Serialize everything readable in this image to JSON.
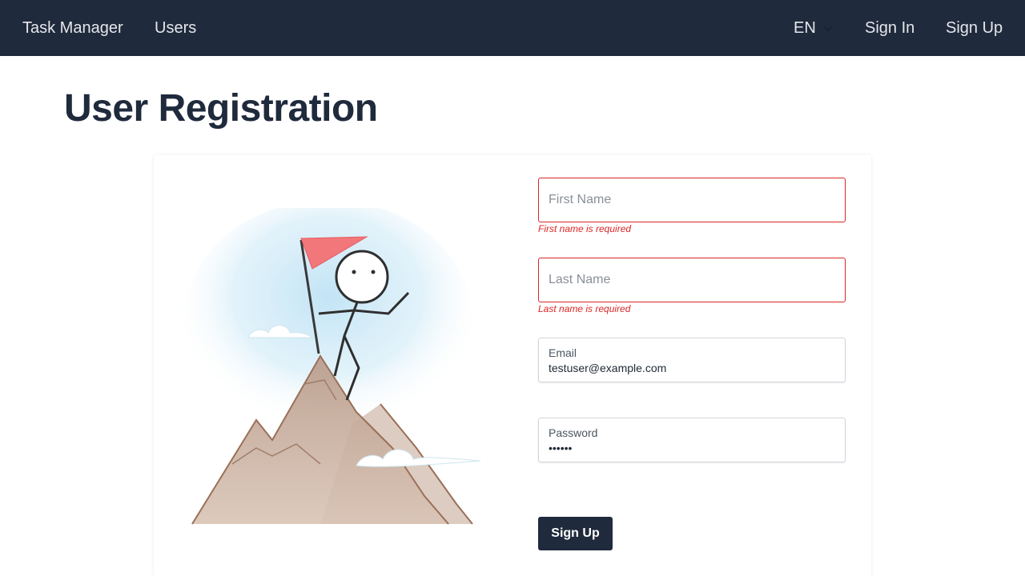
{
  "navbar": {
    "brand": "Task Manager",
    "links": [
      "Users"
    ],
    "language": "EN",
    "sign_in": "Sign In",
    "sign_up": "Sign Up",
    "background": "#1f2a3c"
  },
  "page": {
    "title": "User Registration"
  },
  "form": {
    "first_name": {
      "placeholder": "First Name",
      "value": "",
      "error": "First name is required"
    },
    "last_name": {
      "placeholder": "Last Name",
      "value": "",
      "error": "Last name is required"
    },
    "email": {
      "label": "Email",
      "value": "testuser@example.com"
    },
    "password": {
      "label": "Password",
      "value": "••••••"
    },
    "submit_label": "Sign Up"
  },
  "colors": {
    "accent": "#1f2a3c",
    "error": "#dc2626"
  },
  "illustration": {
    "icon": "mountain-summit-flag-illustration"
  }
}
